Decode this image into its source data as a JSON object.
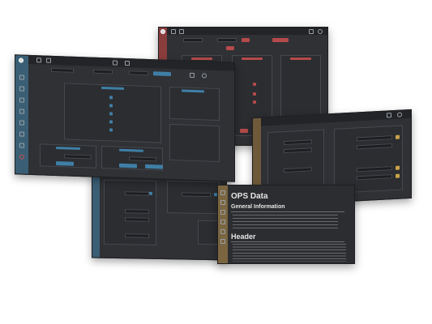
{
  "docs_window": {
    "title": "OPS Data",
    "sections": [
      {
        "heading": "General Information"
      },
      {
        "heading": "Header"
      }
    ]
  },
  "colors": {
    "accent_red": "#b54a4a",
    "accent_blue": "#3f7fa6",
    "accent_gold": "#c9a24a",
    "panel_bg": "#2f3135",
    "sidebar_blue": "#3a5f75",
    "sidebar_red": "#8a3d3d",
    "sidebar_tan": "#6e5a3a"
  },
  "icons": [
    "home-icon",
    "save-icon",
    "copy-icon",
    "export-icon",
    "print-icon",
    "settings-icon",
    "help-icon"
  ]
}
